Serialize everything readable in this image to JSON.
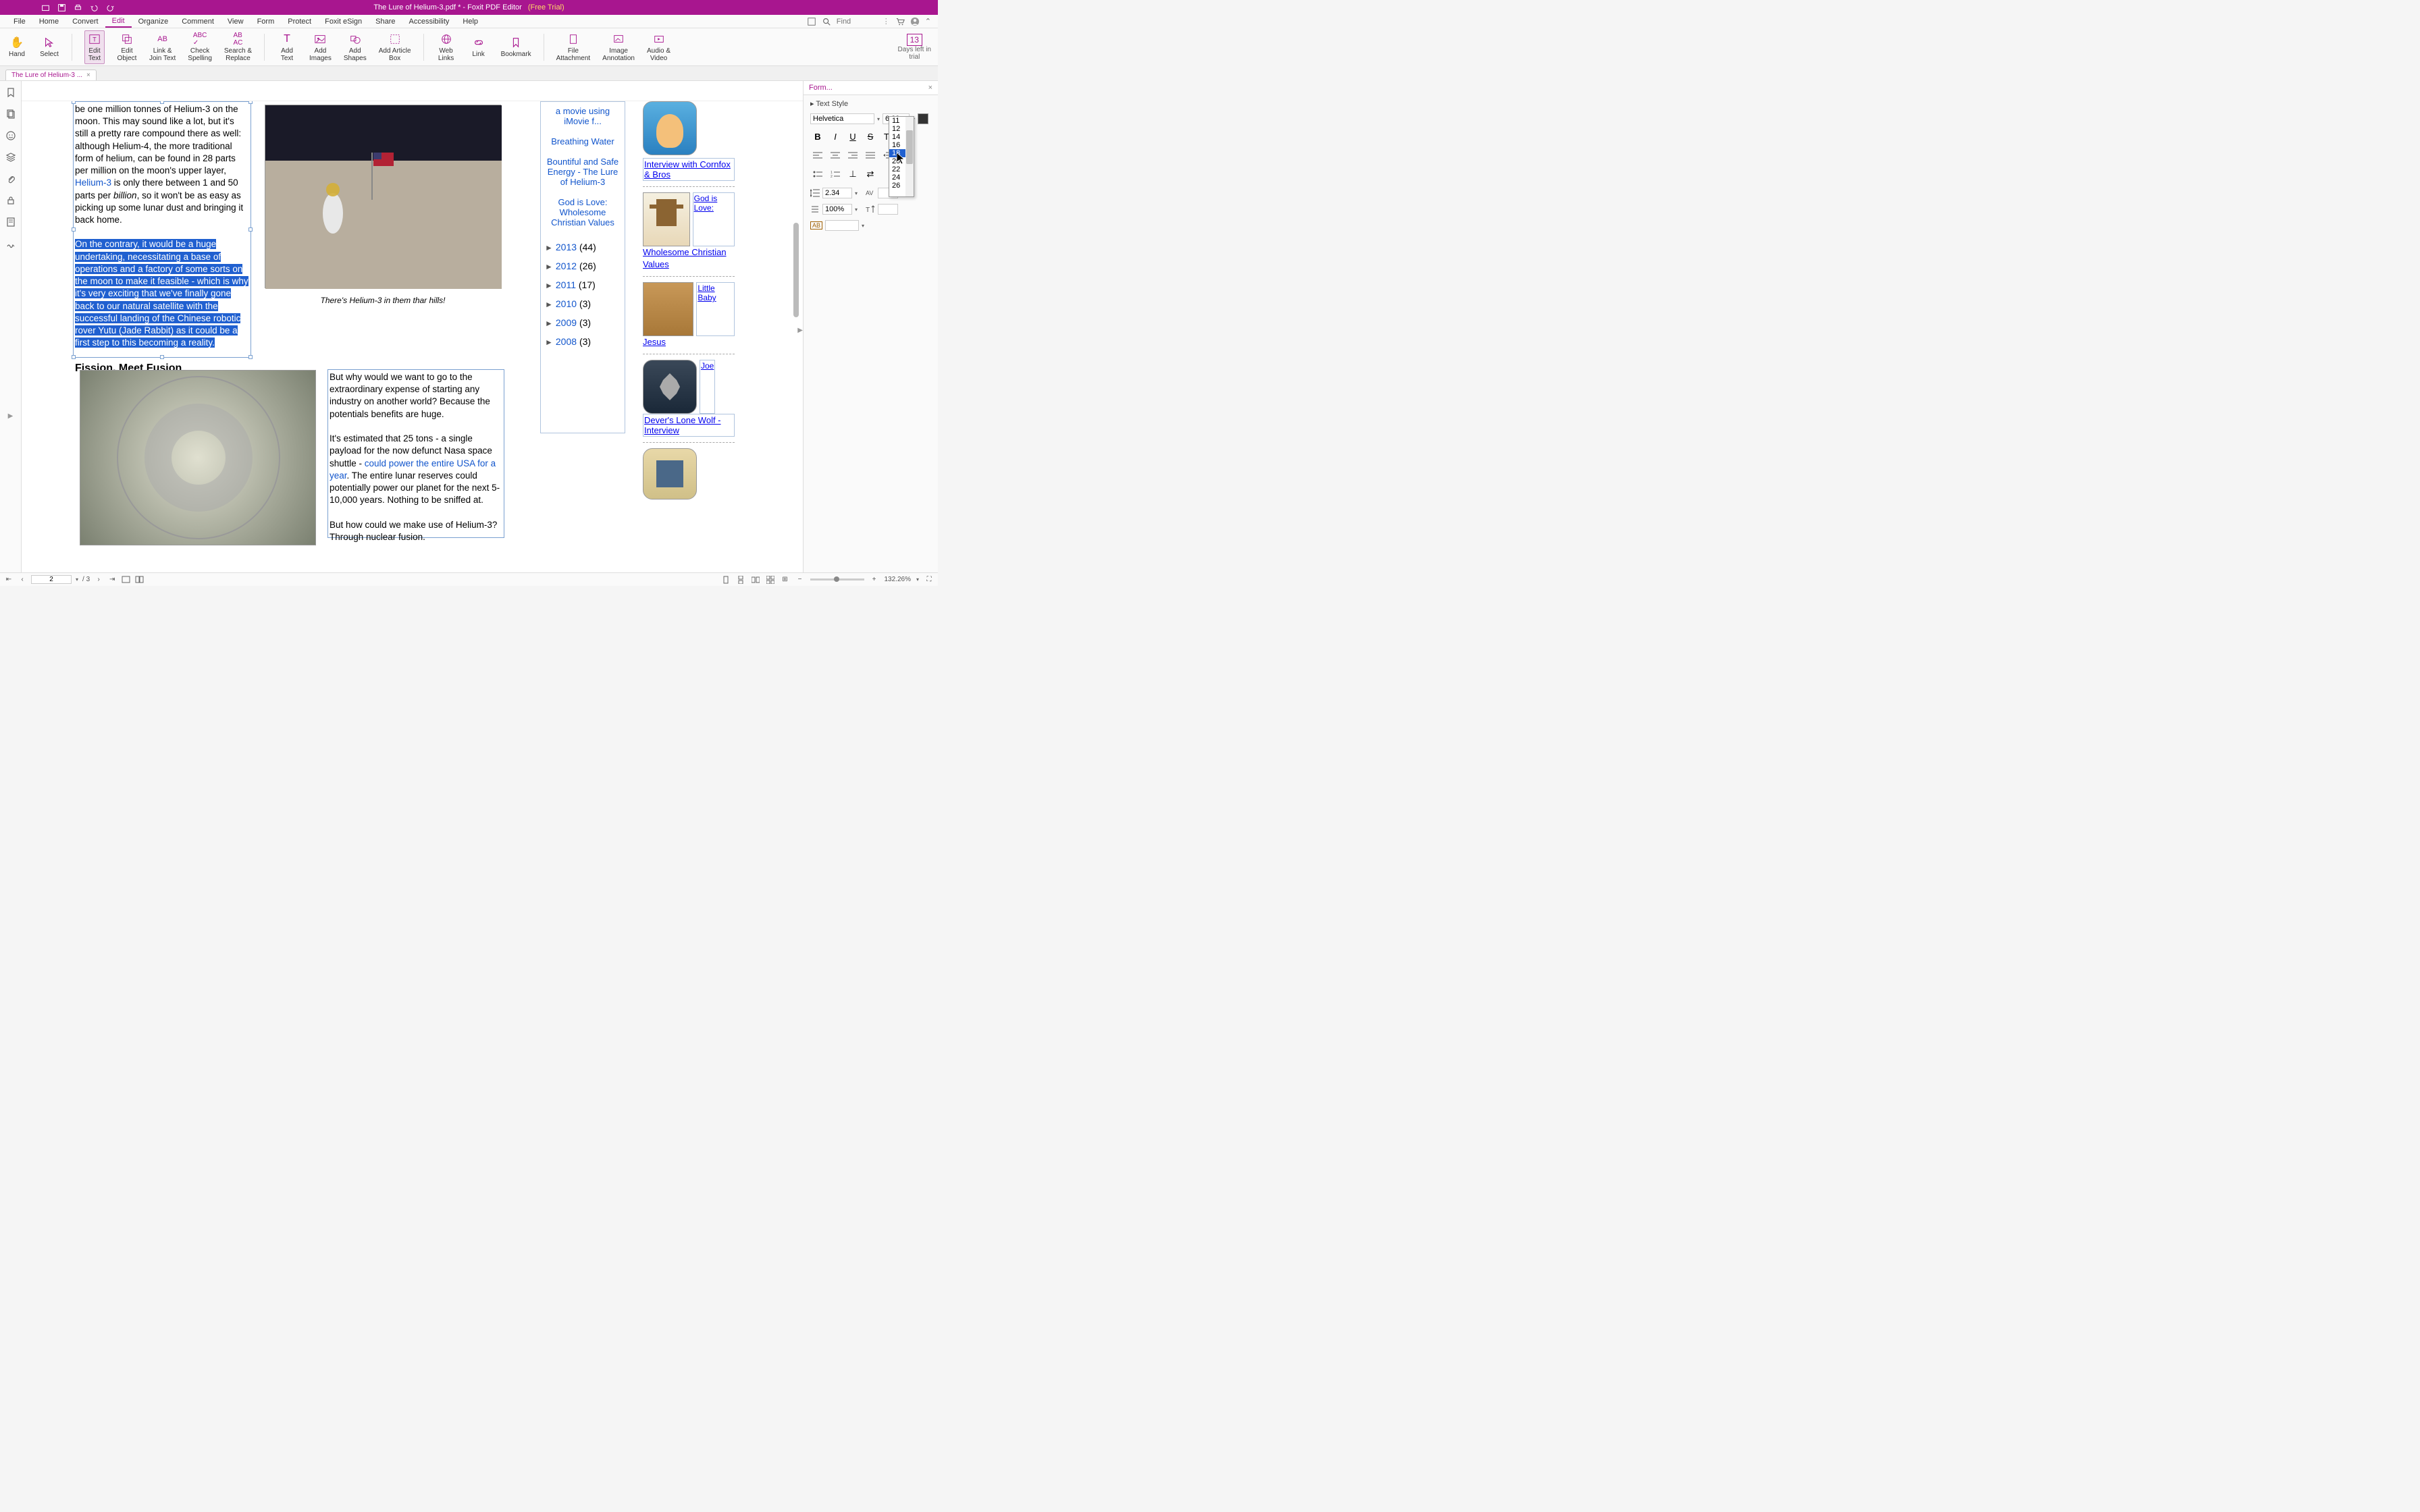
{
  "titlebar": {
    "filename": "The Lure of Helium-3.pdf *",
    "app": " - Foxit PDF Editor  ",
    "trial": "(Free Trial)"
  },
  "menubar": {
    "items": [
      "File",
      "Home",
      "Convert",
      "Edit",
      "Organize",
      "Comment",
      "View",
      "Form",
      "Protect",
      "Foxit eSign",
      "Share",
      "Accessibility",
      "Help"
    ],
    "active": "Edit",
    "find_placeholder": "Find"
  },
  "ribbon": {
    "items": [
      {
        "label": "Hand"
      },
      {
        "label": "Select"
      },
      {
        "label": "Edit\nText",
        "active": true
      },
      {
        "label": "Edit\nObject"
      },
      {
        "label": "Link &\nJoin Text"
      },
      {
        "label": "Check\nSpelling"
      },
      {
        "label": "Search &\nReplace"
      },
      {
        "label": "Add\nText"
      },
      {
        "label": "Add\nImages"
      },
      {
        "label": "Add\nShapes"
      },
      {
        "label": "Add Article\nBox"
      },
      {
        "label": "Web\nLinks"
      },
      {
        "label": "Link"
      },
      {
        "label": "Bookmark"
      },
      {
        "label": "File\nAttachment"
      },
      {
        "label": "Image\nAnnotation"
      },
      {
        "label": "Audio &\nVideo"
      }
    ],
    "trial_days": "13",
    "trial_label": "Days left in\ntrial"
  },
  "doc_tab": "The Lure of Helium-3 ...",
  "left_rail_icons": [
    "bookmark",
    "pages",
    "comments",
    "layers",
    "attachments",
    "security",
    "signatures",
    "stamps"
  ],
  "document": {
    "para1_pre": "be one million tonnes of Helium-3 on the moon. This may sound like a lot, but it's still a pretty rare compound there as well: although Helium-4, the more traditional form of helium, can be found in 28 parts per million on the moon's upper layer, ",
    "para1_link": "Helium-3",
    "para1_post": " is only there between 1 and 50 parts per ",
    "para1_billion": "billion",
    "para1_end": ", so it won't be as easy as picking up some lunar dust and bringing it back home.",
    "para2_highlight": "On the contrary, it would be a huge undertaking, necessitating a base of operations and a factory of some sorts on the moon to make it feasible - which is why it's very exciting that we've finally gone back to our natural satellite with the successful landing of the Chinese robotic rover Yutu (Jade Rabbit) as it could be a first step to this becoming a reality.",
    "heading1": "Fission, Meet Fusion",
    "caption1": "There's Helium-3 in them thar hills!",
    "para3": "But why would we want to go to the extraordinary expense of starting any industry on another world? Because the potentials benefits are huge.",
    "para4_pre": "It's estimated that 25 tons - a single payload for the now defunct Nasa space shuttle - ",
    "para4_link": "could power the entire USA for a year",
    "para4_post": ". The entire lunar reserves could potentially power our planet for the next 5-10,000 years. Nothing to be sniffed at.",
    "para5": "But how could we make use of Helium-3? Through nuclear fusion.",
    "sidebar_links": {
      "l1": "a movie using iMovie f...",
      "l2": "Breathing Water",
      "l3": "Bountiful and Safe Energy - The Lure of Helium-3",
      "l4": "God is Love: Wholesome Christian Values",
      "y2013": "2013 ",
      "c2013": "(44)",
      "y2012": "2012 ",
      "c2012": "(26)",
      "y2011": "2011 ",
      "c2011": "(17)",
      "y2010": "2010 ",
      "c2010": "(3)",
      "y2009": "2009 ",
      "c2009": "(3)",
      "y2008": "2008 ",
      "c2008": "(3)",
      "thumb1": "Interview with Cornfox & Bros",
      "thumb2_title": "God is Love:",
      "thumb2": "Wholesome Christian Values",
      "thumb3_title": "Little Baby",
      "thumb3": "Jesus",
      "thumb4_title": "Joe",
      "thumb4": "Dever's Lone Wolf - Interview"
    }
  },
  "format_panel": {
    "tab": "Form...",
    "section": "Text Style",
    "font": "Helvetica",
    "size": "6.99",
    "line_spacing": "2.34",
    "scale": "100%",
    "size_options": [
      "11",
      "12",
      "14",
      "16",
      "18",
      "20",
      "22",
      "24",
      "26"
    ],
    "size_selected": "18"
  },
  "statusbar": {
    "page_current": "2",
    "page_total": "3",
    "zoom": "132.26%"
  }
}
